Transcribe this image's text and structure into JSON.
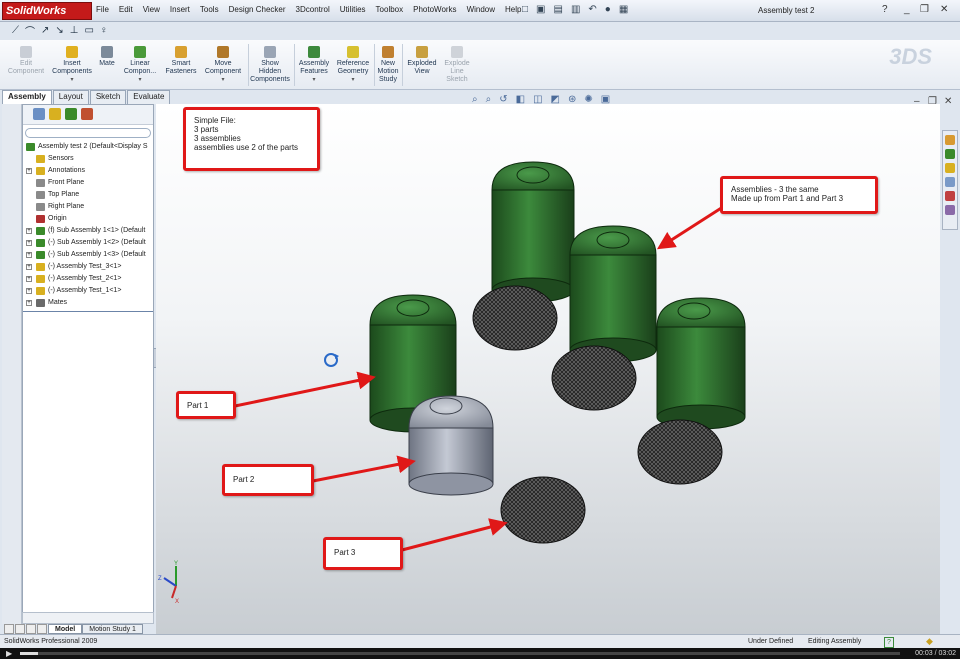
{
  "app": {
    "logo_text": "SolidWorks",
    "document_title": "Assembly test 2",
    "menu": [
      "File",
      "Edit",
      "View",
      "Insert",
      "Tools",
      "Design Checker",
      "3Dcontrol",
      "Utilities",
      "Toolbox",
      "PhotoWorks",
      "Window",
      "Help"
    ]
  },
  "command_manager": {
    "edit_component": "Edit Component",
    "insert_components": "Insert Components",
    "mate": "Mate",
    "linear_component": "Linear Compon...",
    "smart_fasteners": "Smart Fasteners",
    "move_component": "Move Component",
    "show_hidden": "Show Hidden Components",
    "assembly_features": "Assembly Features",
    "reference_geometry": "Reference Geometry",
    "new_motion_study": "New Motion Study",
    "exploded_view": "Exploded View",
    "explode_line_sketch": "Explode Line Sketch"
  },
  "tabs": [
    "Assembly",
    "Layout",
    "Sketch",
    "Evaluate"
  ],
  "tree": {
    "items": [
      {
        "label": "Assembly test 2  (Default<Display S",
        "color": "#3a8a2a",
        "indent": 0,
        "expand": false
      },
      {
        "label": "Sensors",
        "color": "#d8b020",
        "indent": 1,
        "expand": false
      },
      {
        "label": "Annotations",
        "color": "#d8b020",
        "indent": 1,
        "expand": true
      },
      {
        "label": "Front Plane",
        "color": "#8a8a8a",
        "indent": 1,
        "expand": false
      },
      {
        "label": "Top Plane",
        "color": "#8a8a8a",
        "indent": 1,
        "expand": false
      },
      {
        "label": "Right Plane",
        "color": "#8a8a8a",
        "indent": 1,
        "expand": false
      },
      {
        "label": "Origin",
        "color": "#b03030",
        "indent": 1,
        "expand": false
      },
      {
        "label": "(f) Sub Assembly 1<1> (Default",
        "color": "#3a8a2a",
        "indent": 1,
        "expand": true
      },
      {
        "label": "(-) Sub Assembly 1<2> (Default",
        "color": "#3a8a2a",
        "indent": 1,
        "expand": true
      },
      {
        "label": "(-) Sub Assembly 1<3> (Default",
        "color": "#3a8a2a",
        "indent": 1,
        "expand": true
      },
      {
        "label": "(-) Assembly Test_3<1>",
        "color": "#d8b020",
        "indent": 1,
        "expand": true
      },
      {
        "label": "(-) Assembly Test_2<1>",
        "color": "#d8b020",
        "indent": 1,
        "expand": true
      },
      {
        "label": "(-) Assembly Test_1<1>",
        "color": "#d8b020",
        "indent": 1,
        "expand": true
      },
      {
        "label": "Mates",
        "color": "#6a6a6a",
        "indent": 1,
        "expand": true
      }
    ]
  },
  "bottom_tabs": [
    "Model",
    "Motion Study 1"
  ],
  "callouts": {
    "simple_file": [
      "Simple File:",
      "3 parts",
      "3 assemblies",
      "assemblies use 2 of the parts"
    ],
    "assemblies": [
      "Assemblies - 3 the same",
      "Made up from Part 1 and Part 3"
    ],
    "part1": "Part 1",
    "part2": "Part  2",
    "part3": "Part 3"
  },
  "status": {
    "product": "SolidWorks Professional 2009",
    "under_defined": "Under Defined",
    "editing": "Editing Assembly",
    "help_icon": "?"
  },
  "player": {
    "time": "00:03 / 03:02",
    "progress": 0.02
  },
  "colors": {
    "green_part": "#2f6d2f",
    "grey_part": "#9aa0ad",
    "mesh_part": "#2a2a2a",
    "callout_red": "#e01818"
  }
}
